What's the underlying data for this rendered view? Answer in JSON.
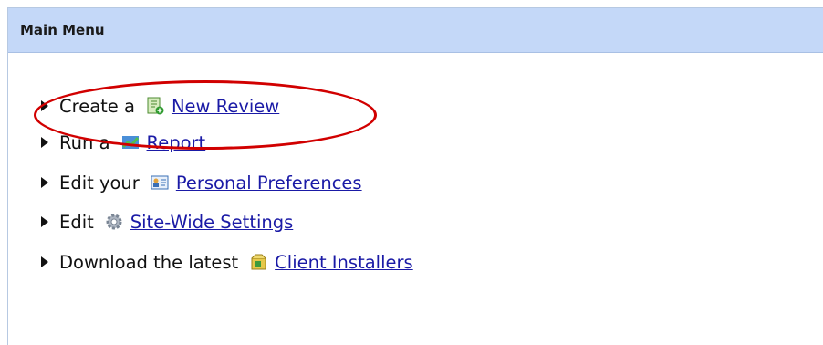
{
  "panel": {
    "title": "Main Menu"
  },
  "menu": [
    {
      "prefix": "Create a",
      "link": "New Review",
      "icon": "new-review-icon"
    },
    {
      "prefix": "Run a",
      "link": "Report",
      "icon": "report-chart-icon"
    },
    {
      "prefix": "Edit your",
      "link": "Personal Preferences",
      "icon": "preferences-icon"
    },
    {
      "prefix": "Edit",
      "link": "Site-Wide Settings",
      "icon": "settings-gear-icon"
    },
    {
      "prefix": "Download the latest",
      "link": "Client Installers",
      "icon": "installer-icon"
    }
  ],
  "colors": {
    "header_bg": "#c4d8f8",
    "link": "#1a1aa6",
    "annotation": "#d10000"
  }
}
